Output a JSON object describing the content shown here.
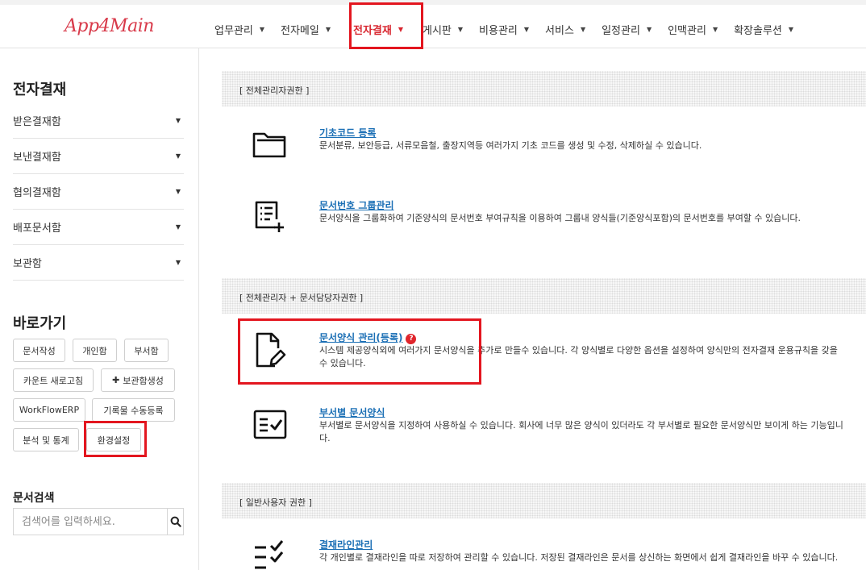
{
  "app": {
    "logo": "App4Main"
  },
  "nav": {
    "items": [
      {
        "label": "업무관리"
      },
      {
        "label": "전자메일"
      },
      {
        "label": "전자결재"
      },
      {
        "label": "게시판"
      },
      {
        "label": "비용관리"
      },
      {
        "label": "서비스"
      },
      {
        "label": "일정관리"
      },
      {
        "label": "인맥관리"
      },
      {
        "label": "확장솔루션"
      }
    ],
    "active": "전자결재"
  },
  "sidebar": {
    "title": "전자결재",
    "menu": [
      {
        "label": "받은결재함"
      },
      {
        "label": "보낸결재함"
      },
      {
        "label": "협의결재함"
      },
      {
        "label": "배포문서함"
      },
      {
        "label": "보관함"
      }
    ],
    "shortcut_title": "바로가기",
    "shortcuts": [
      {
        "label": "문서작성"
      },
      {
        "label": "개인함"
      },
      {
        "label": "부서함"
      },
      {
        "label": "카운트 새로고침"
      },
      {
        "label": "보관함생성"
      },
      {
        "label": "WorkFlowERP"
      },
      {
        "label": "기록물 수동등록"
      },
      {
        "label": "분석 및 통계"
      },
      {
        "label": "환경설정"
      }
    ],
    "search_title": "문서검색",
    "search_placeholder": "검색어를 입력하세요."
  },
  "main": {
    "sections": [
      {
        "header": "[ 전체관리자권한 ]",
        "items": [
          {
            "title": "기초코드 등록",
            "desc": "문서분류, 보안등급, 서류모음철, 출장지역등 여러가지 기초 코드를 생성 및 수정, 삭제하실 수 있습니다.",
            "icon": "folder-icon"
          },
          {
            "title": "문서번호 그룹관리",
            "desc": "문서양식을 그룹화하여 기준양식의 문서번호 부여규칙을 이용하여 그룹내 양식들(기준양식포함)의 문서번호를 부여할 수 있습니다.",
            "icon": "list-add-icon"
          }
        ]
      },
      {
        "header": "[ 전체관리자 + 문서담당자권한 ]",
        "items": [
          {
            "title": "문서양식 관리(등록)",
            "desc": "시스템 제공양식외에 여러가지 문서양식을 추가로 만들수 있습니다. 각 양식별로 다양한 옵션을 설정하여 양식만의 전자결재 운용규칙을 갖을 수 있습니다.",
            "icon": "document-edit-icon",
            "help": "?"
          },
          {
            "title": "부서별 문서양식",
            "desc": "부서별로 문서양식을 지정하여 사용하실 수 있습니다. 회사에 너무 많은 양식이 있더라도 각 부서별로 필요한 문서양식만 보이게 하는 기능입니다.",
            "icon": "checklist-box-icon"
          }
        ]
      },
      {
        "header": "[ 일반사용자 권한 ]",
        "items": [
          {
            "title": "결재라인관리",
            "desc": "각 개인별로 결재라인을 따로 저장하여 관리할 수 있습니다. 저장된 결재라인은 문서를 상신하는 화면에서 쉽게 결재라인을 바꾸 수 있습니다.",
            "icon": "checklist-icon"
          }
        ]
      }
    ]
  },
  "colors": {
    "accent": "#d8262f",
    "link": "#1b6fb5",
    "highlight_frame": "#e3161f"
  }
}
